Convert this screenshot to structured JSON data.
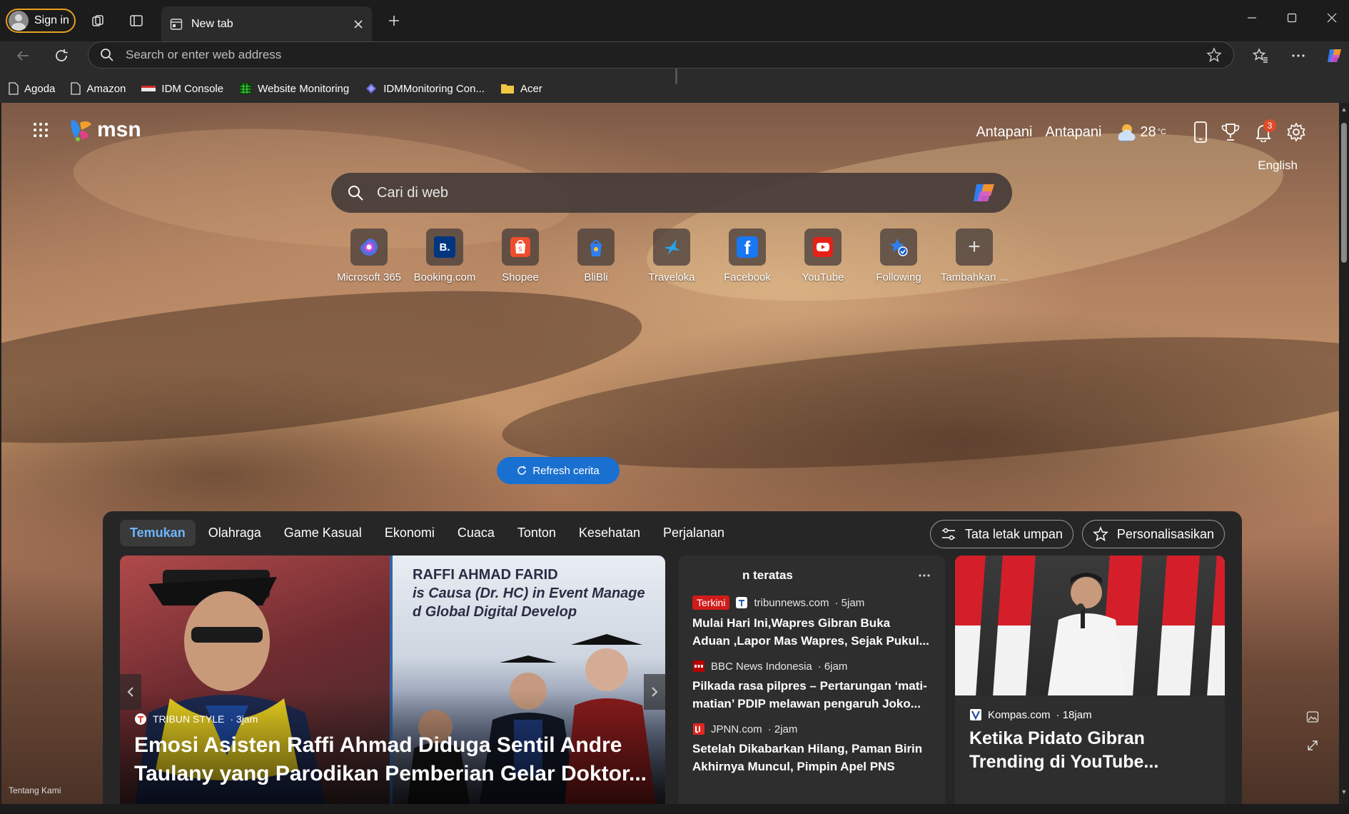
{
  "browser": {
    "sign_in_label": "Sign in",
    "tab_title": "New tab",
    "address_placeholder": "Search or enter web address",
    "bookmarks": [
      {
        "label": "Agoda",
        "icon": "page-icon"
      },
      {
        "label": "Amazon",
        "icon": "page-icon"
      },
      {
        "label": "IDM Console",
        "icon": "idm-icon"
      },
      {
        "label": "Website Monitoring",
        "icon": "monitor-icon"
      },
      {
        "label": "IDMMonitoring Con...",
        "icon": "idm-cloud-icon"
      },
      {
        "label": "Acer",
        "icon": "folder-icon"
      }
    ]
  },
  "msn": {
    "brand": "msn",
    "location_1": "Antapani",
    "location_2": "Antapani",
    "temperature": "28",
    "temp_unit": "°C",
    "notification_count": "3",
    "language": "English",
    "search_placeholder": "Cari di web",
    "quick_links": [
      {
        "label": "Microsoft 365",
        "icon": "microsoft365-icon"
      },
      {
        "label": "Booking.com",
        "icon": "booking-icon",
        "glyph": "B."
      },
      {
        "label": "Shopee",
        "icon": "shopee-icon"
      },
      {
        "label": "BliBli",
        "icon": "blibli-icon"
      },
      {
        "label": "Traveloka",
        "icon": "traveloka-icon"
      },
      {
        "label": "Facebook",
        "icon": "facebook-icon",
        "glyph": "f"
      },
      {
        "label": "YouTube",
        "icon": "youtube-icon"
      },
      {
        "label": "Following",
        "icon": "following-icon"
      },
      {
        "label": "Tambahkan ...",
        "icon": "plus-icon",
        "glyph": "+"
      }
    ],
    "footer_link": "Tentang Kami"
  },
  "feed": {
    "tabs": [
      "Temukan",
      "Olahraga",
      "Game Kasual",
      "Ekonomi",
      "Cuaca",
      "Tonton",
      "Kesehatan",
      "Perjalanan"
    ],
    "layout_button": "Tata letak umpan",
    "personalize_button": "Personalisasikan",
    "refresh_label": "Refresh cerita",
    "hero": {
      "source": "TRIBUN STYLE",
      "time": "· 3jam",
      "headline": "Emosi Asisten Raffi Ahmad Diduga Sentil Andre Taulany yang Parodikan Pemberian Gelar Doktor...",
      "image_text_1": "RAFFI AHMAD FARID",
      "image_text_2": "is Causa (Dr. HC) in Event Manage",
      "image_text_3": "d Global Digital Develop"
    },
    "top_news": {
      "heading": "n teratas",
      "items": [
        {
          "badge": "Terkini",
          "source": "tribunnews.com",
          "time": "· 5jam",
          "title": "Mulai Hari Ini,Wapres Gibran Buka Aduan ,Lapor Mas Wapres, Sejak Pukul..."
        },
        {
          "badge": "",
          "source": "BBC News Indonesia",
          "time": "· 6jam",
          "title": "Pilkada rasa pilpres – Pertarungan ‘mati-matian’ PDIP melawan pengaruh Joko..."
        },
        {
          "badge": "",
          "source": "JPNN.com",
          "time": "· 2jam",
          "title": "Setelah Dikabarkan Hilang, Paman Birin Akhirnya Muncul, Pimpin Apel PNS"
        }
      ]
    },
    "side_card": {
      "source": "Kompas.com",
      "time": "· 18jam",
      "title": "Ketika Pidato Gibran Trending di YouTube..."
    }
  },
  "colors": {
    "accent": "#1a70d0",
    "active_tab_text": "#6fb6ff",
    "badge_red": "#d11a1a",
    "signin_border": "#e8a020"
  }
}
